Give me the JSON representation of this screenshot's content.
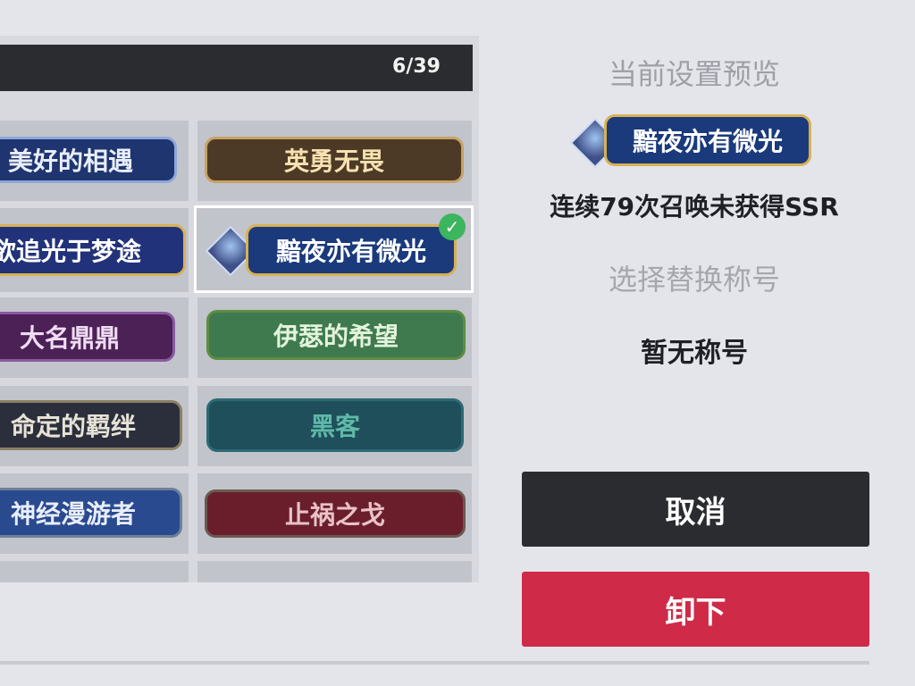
{
  "title_list": {
    "count": "6/39",
    "items": [
      {
        "id": "meet",
        "label": "美好的相遇",
        "bg": "#1f3570",
        "fg": "#e9eefc",
        "border": "#8fa6d8"
      },
      {
        "id": "brave",
        "label": "英勇无畏",
        "bg": "#4d3a26",
        "fg": "#f7e1b0",
        "border": "#c7a266"
      },
      {
        "id": "chase",
        "label": "欲追光于梦途",
        "bg": "#22327a",
        "fg": "#ffffff",
        "border": "#d8b154"
      },
      {
        "id": "dark",
        "label": "黯夜亦有微光",
        "bg": "#1a3a7c",
        "fg": "#ffffff",
        "border": "#d8b154",
        "selected": true
      },
      {
        "id": "famous",
        "label": "大名鼎鼎",
        "bg": "#4b2156",
        "fg": "#f0dcf4",
        "border": "#8a5aa0"
      },
      {
        "id": "hope",
        "label": "伊瑟的希望",
        "bg": "#3f7a4f",
        "fg": "#e3f4dc",
        "border": "#5d8c43"
      },
      {
        "id": "bond",
        "label": "命定的羁绊",
        "bg": "#2b2f3c",
        "fg": "#e6e2d6",
        "border": "#8b7f63"
      },
      {
        "id": "hacker",
        "label": "黑客",
        "bg": "#1e4f5a",
        "fg": "#5fb9a8",
        "border": "#2d6a75"
      },
      {
        "id": "wander",
        "label": "神经漫游者",
        "bg": "#2a4a8f",
        "fg": "#e8eefc",
        "border": "#6e7f99"
      },
      {
        "id": "halt",
        "label": "止祸之戈",
        "bg": "#6a1e2c",
        "fg": "#e9c2c7",
        "border": "#6b5a4f"
      }
    ]
  },
  "preview": {
    "heading": "当前设置预览",
    "badge_label": "黯夜亦有微光",
    "description": "连续79次召唤未获得SSR",
    "replace_heading": "选择替换称号",
    "replace_value": "暂无称号"
  },
  "buttons": {
    "cancel": "取消",
    "unequip": "卸下"
  },
  "colors": {
    "cancel_bg": "#2b2c30",
    "unequip_bg": "#cf2a48",
    "check": "#3bb55e"
  }
}
